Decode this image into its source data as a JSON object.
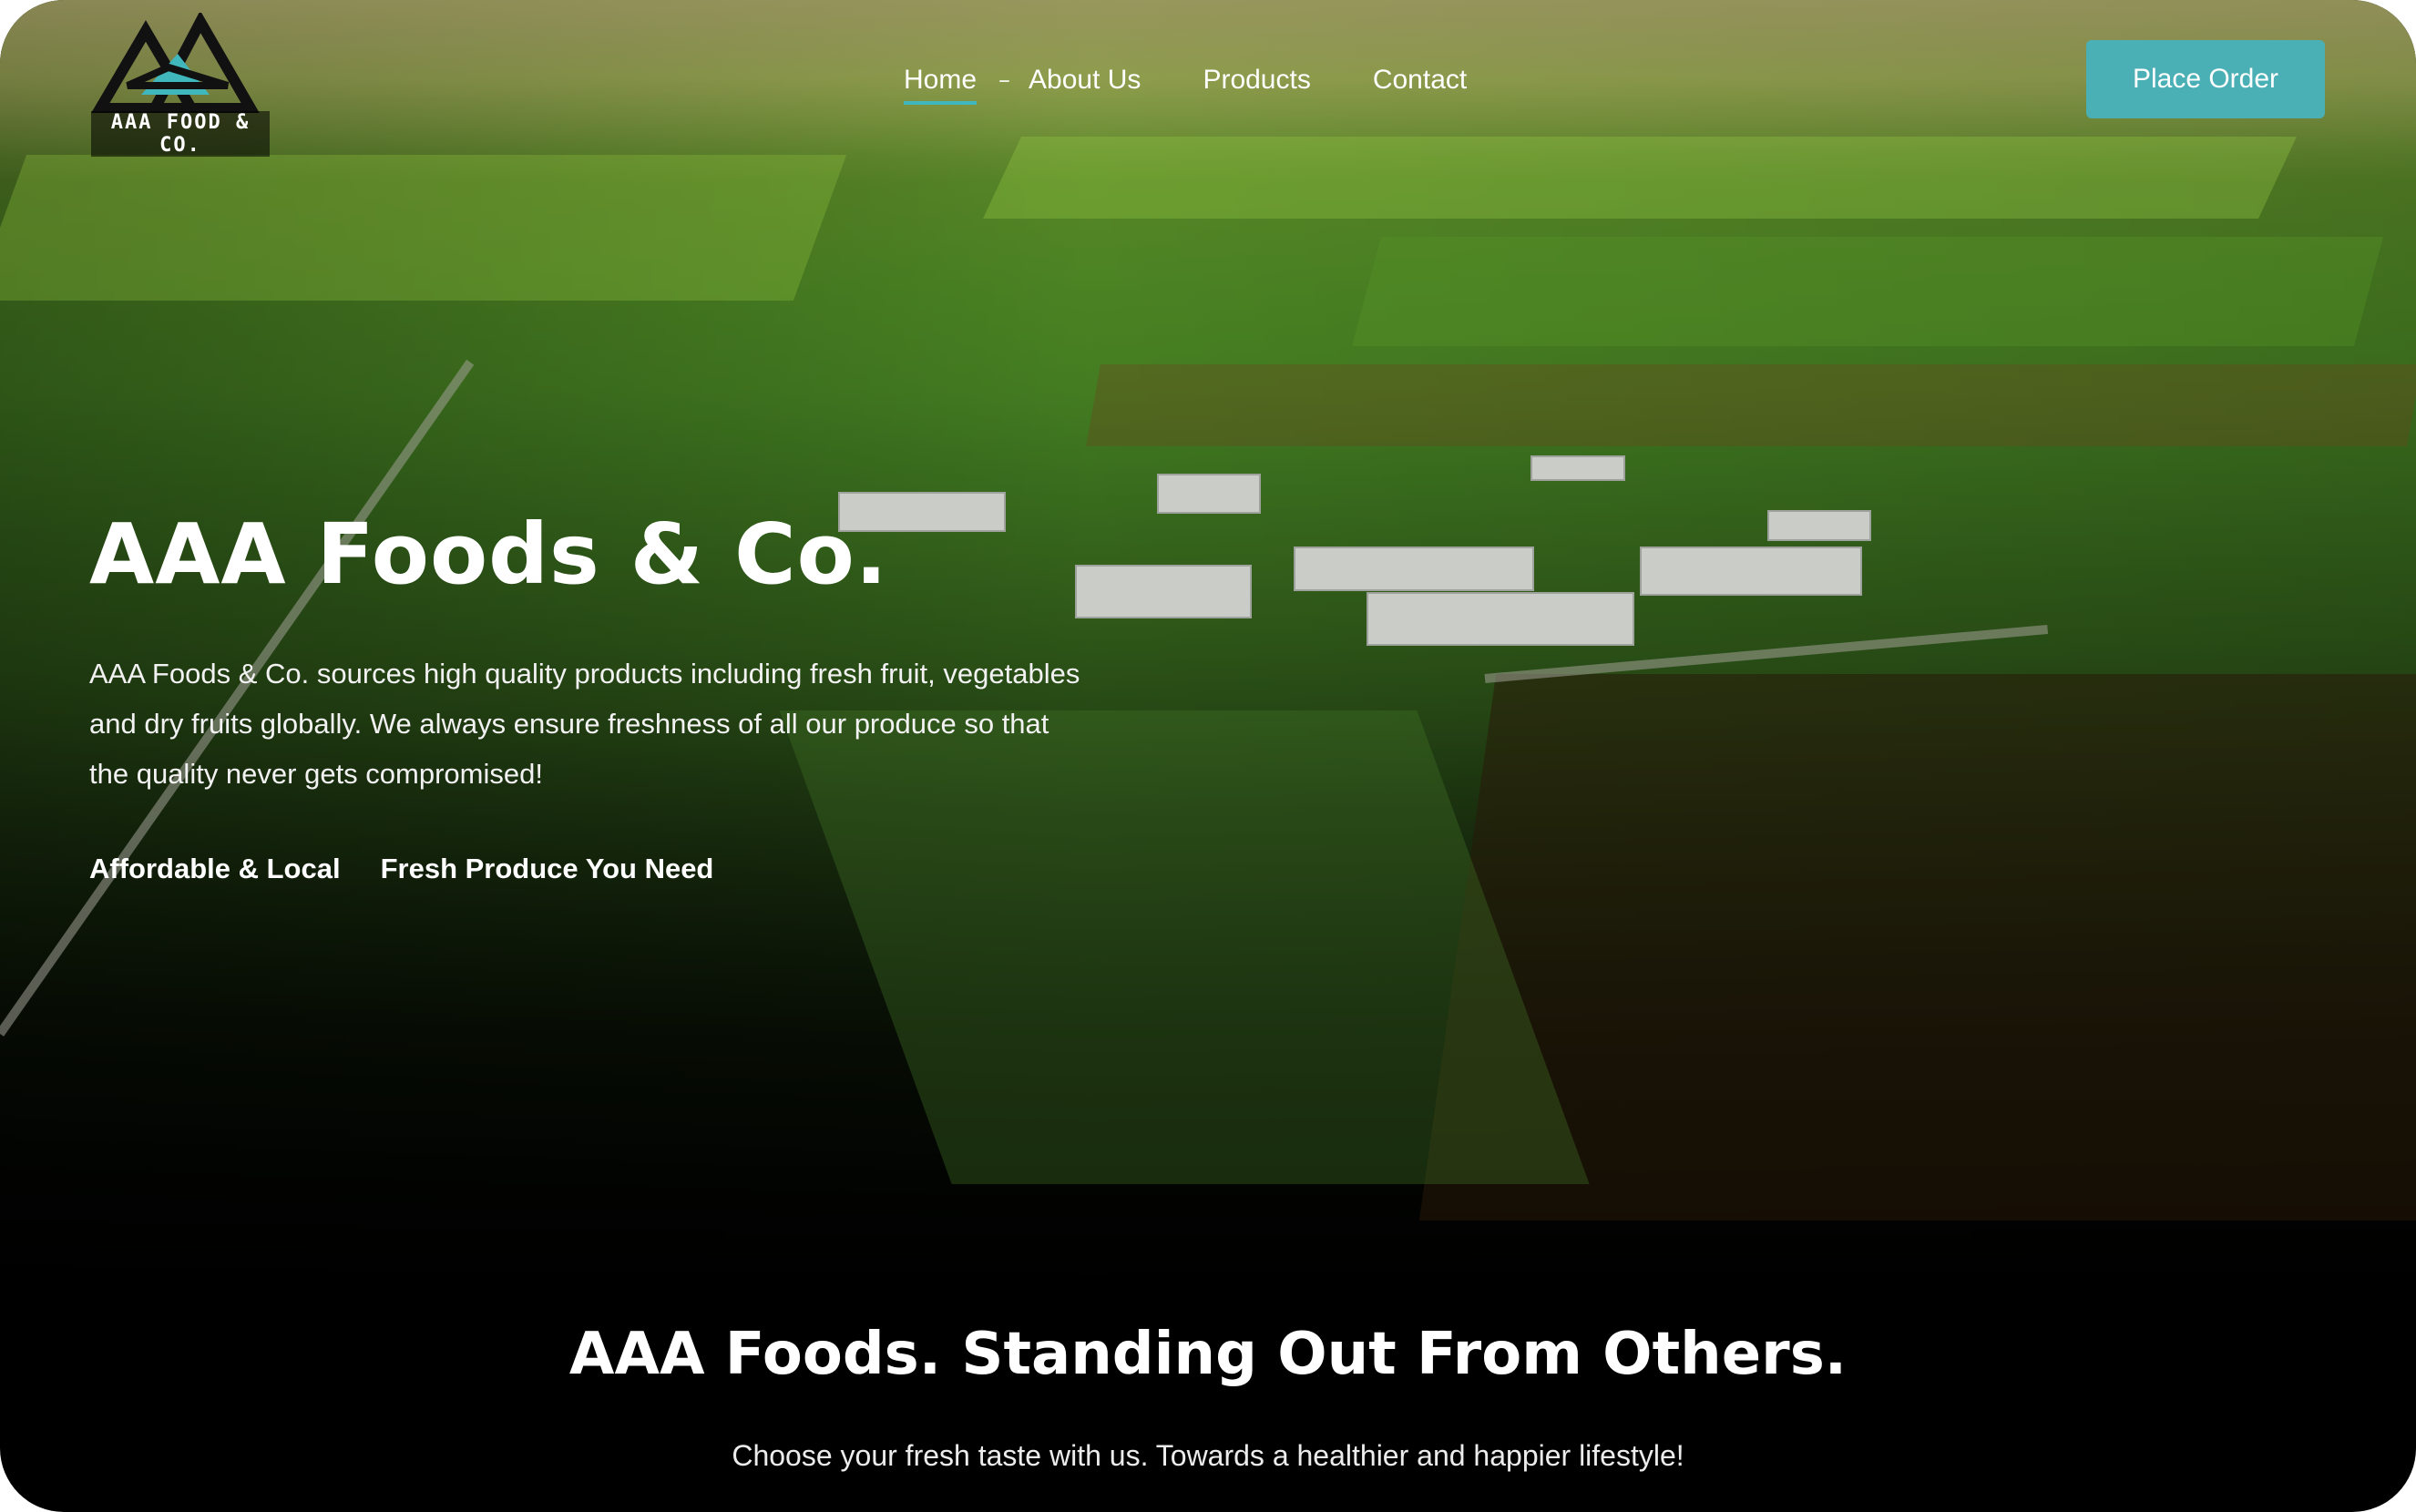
{
  "brand": {
    "logo_text": "AAA FOOD & CO.",
    "accent_color": "#4bb0b6"
  },
  "nav": {
    "items": [
      {
        "label": "Home",
        "active": true
      },
      {
        "label": "About Us",
        "active": false
      },
      {
        "label": "Products",
        "active": false
      },
      {
        "label": "Contact",
        "active": false
      }
    ],
    "cta_label": "Place Order"
  },
  "hero": {
    "title": "AAA Foods & Co.",
    "description": "AAA Foods & Co. sources high quality products including fresh fruit, vegetables and dry fruits globally. We always ensure freshness of all our produce so that the quality never gets compromised!",
    "tags": [
      "Affordable & Local",
      "Fresh Produce You Need"
    ]
  },
  "section": {
    "title": "AAA Foods. Standing Out From Others.",
    "subtitle": "Choose your fresh taste with us. Towards a healthier and happier lifestyle!"
  }
}
